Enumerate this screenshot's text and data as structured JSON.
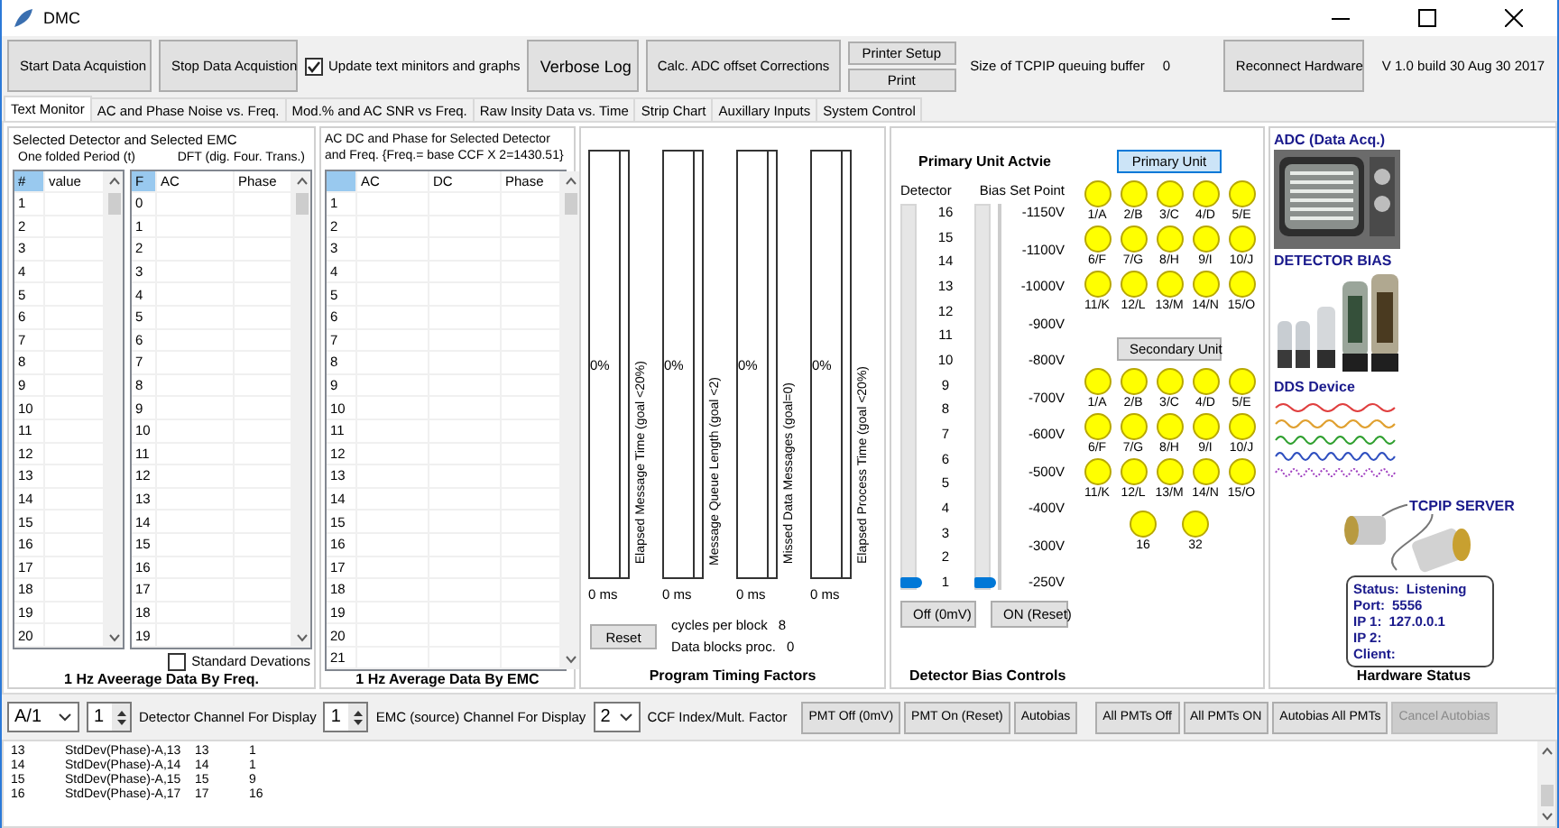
{
  "window": {
    "title": "DMC"
  },
  "toolbar": {
    "start_button": "Start Data Acquistion",
    "stop_button": "Stop Data Acquistion",
    "update_checkbox": {
      "label": "Update text minitors and graphs",
      "checked": true
    },
    "verbose_button": "Verbose Log",
    "calc_button": "Calc. ADC offset Corrections",
    "printer_setup_button": "Printer Setup",
    "print_button": "Print",
    "queue_label": "Size of TCPIP queuing buffer",
    "queue_value": "0",
    "reconnect_button": "Reconnect Hardware",
    "version": "V 1.0 build 30 Aug 30 2017"
  },
  "tabs": [
    {
      "label": "Text Monitor",
      "selected": true
    },
    {
      "label": "AC and Phase Noise vs. Freq.",
      "selected": false
    },
    {
      "label": "Mod.% and AC SNR vs Freq.",
      "selected": false
    },
    {
      "label": "Raw Insity Data vs. Time",
      "selected": false
    },
    {
      "label": "Strip Chart",
      "selected": false
    },
    {
      "label": "Auxillary Inputs",
      "selected": false
    },
    {
      "label": "System Control",
      "selected": false
    }
  ],
  "detector_panel": {
    "title": "Selected Detector and Selected EMC",
    "period_caption": "One folded Period (t)",
    "dft_caption": "DFT (dig. Four. Trans.)",
    "period_table": {
      "index_header": "#",
      "columns": [
        "value"
      ],
      "rows": [
        "1",
        "2",
        "3",
        "4",
        "5",
        "6",
        "7",
        "8",
        "9",
        "10",
        "11",
        "12",
        "13",
        "14",
        "15",
        "16",
        "17",
        "18",
        "19",
        "20"
      ]
    },
    "dft_table": {
      "index_header": "F",
      "columns": [
        "AC",
        "Phase"
      ],
      "rows": [
        "0",
        "1",
        "2",
        "3",
        "4",
        "5",
        "6",
        "7",
        "8",
        "9",
        "10",
        "11",
        "12",
        "13",
        "14",
        "15",
        "16",
        "17",
        "18",
        "19"
      ]
    },
    "std_dev_checkbox": {
      "label": "Standard Devations",
      "checked": false
    },
    "footer": "1 Hz Aveerage Data By Freq."
  },
  "emc_panel": {
    "title": "AC DC and Phase for Selected Detector and Freq.  {Freq.= base CCF X 2=1430.51}",
    "table": {
      "columns": [
        "AC",
        "DC",
        "Phase"
      ],
      "rows": [
        "1",
        "2",
        "3",
        "4",
        "5",
        "6",
        "7",
        "8",
        "9",
        "10",
        "11",
        "12",
        "13",
        "14",
        "15",
        "16",
        "17",
        "18",
        "19",
        "20",
        "21"
      ]
    },
    "footer": "1 Hz Average Data By EMC"
  },
  "timing_panel": {
    "bars": [
      {
        "label": "Elapsed Message Time (goal <20%)",
        "percent": "0%",
        "time": "0 ms"
      },
      {
        "label": "Message Queue Length (goal <2)",
        "percent": "0%",
        "time": "0 ms"
      },
      {
        "label": "Missed Data Messages (goal=0)",
        "percent": "0%",
        "time": "0 ms"
      },
      {
        "label": "Elapsed Process Time (goal <20%)",
        "percent": "0%",
        "time": "0 ms"
      }
    ],
    "reset_button": "Reset",
    "cycles_label": "cycles per block",
    "cycles_value": "8",
    "blocks_label": "Data blocks proc.",
    "blocks_value": "0",
    "footer": "Program Timing Factors"
  },
  "bias_panel": {
    "title": "Primary Unit Actvie",
    "detector_label": "Detector",
    "setpoint_label": "Bias Set Point",
    "detector_slider": {
      "ticks": [
        "16",
        "15",
        "14",
        "13",
        "12",
        "11",
        "10",
        "9",
        "8",
        "7",
        "6",
        "5",
        "4",
        "3",
        "2",
        "1"
      ],
      "level": 0
    },
    "setpoint_slider": {
      "ticks": [
        "-1150V",
        "-1100V",
        "-1000V",
        "-900V",
        "-800V",
        "-700V",
        "-600V",
        "-500V",
        "-400V",
        "-300V",
        "-250V"
      ],
      "level": 0
    },
    "off_button": "Off (0mV)",
    "on_button": "ON (Reset)",
    "units": [
      {
        "label": "Primary Unit",
        "selected": true,
        "lamps": [
          {
            "label": "1/A",
            "color": "#ffff00"
          },
          {
            "label": "2/B",
            "color": "#ffff00"
          },
          {
            "label": "3/C",
            "color": "#ffff00"
          },
          {
            "label": "4/D",
            "color": "#ffff00"
          },
          {
            "label": "5/E",
            "color": "#ffff00"
          },
          {
            "label": "6/F",
            "color": "#ffff00"
          },
          {
            "label": "7/G",
            "color": "#ffff00"
          },
          {
            "label": "8/H",
            "color": "#ffff00"
          },
          {
            "label": "9/I",
            "color": "#ffff00"
          },
          {
            "label": "10/J",
            "color": "#ffff00"
          },
          {
            "label": "11/K",
            "color": "#ffff00"
          },
          {
            "label": "12/L",
            "color": "#ffff00"
          },
          {
            "label": "13/M",
            "color": "#ffff00"
          },
          {
            "label": "14/N",
            "color": "#ffff00"
          },
          {
            "label": "15/O",
            "color": "#ffff00"
          }
        ]
      },
      {
        "label": "Secondary Unit",
        "selected": false,
        "lamps": [
          {
            "label": "1/A",
            "color": "#ffff00"
          },
          {
            "label": "2/B",
            "color": "#ffff00"
          },
          {
            "label": "3/C",
            "color": "#ffff00"
          },
          {
            "label": "4/D",
            "color": "#ffff00"
          },
          {
            "label": "5/E",
            "color": "#ffff00"
          },
          {
            "label": "6/F",
            "color": "#ffff00"
          },
          {
            "label": "7/G",
            "color": "#ffff00"
          },
          {
            "label": "8/H",
            "color": "#ffff00"
          },
          {
            "label": "9/I",
            "color": "#ffff00"
          },
          {
            "label": "10/J",
            "color": "#ffff00"
          },
          {
            "label": "11/K",
            "color": "#ffff00"
          },
          {
            "label": "12/L",
            "color": "#ffff00"
          },
          {
            "label": "13/M",
            "color": "#ffff00"
          },
          {
            "label": "14/N",
            "color": "#ffff00"
          },
          {
            "label": "15/O",
            "color": "#ffff00"
          }
        ]
      }
    ],
    "extra_lamps": [
      {
        "label": "16",
        "color": "#ffff00"
      },
      {
        "label": "32",
        "color": "#ffff00"
      }
    ],
    "footer": "Detector Bias Controls"
  },
  "hardware_panel": {
    "adc_title": "ADC (Data Acq.)",
    "bias_title": "DETECTOR BIAS",
    "dds_title": "DDS Device",
    "server_title": "TCPIP SERVER",
    "status": [
      {
        "label": "Status:",
        "value": "Listening"
      },
      {
        "label": "Port:",
        "value": "5556"
      },
      {
        "label": "IP 1:",
        "value": "127.0.0.1"
      },
      {
        "label": "IP 2:"
      },
      {
        "label": "Client:"
      }
    ],
    "footer": "Hardware Status"
  },
  "controls": {
    "detector_select": "A/1",
    "detector_spinner": "1",
    "detector_label": "Detector Channel For Display",
    "emc_spinner": "1",
    "emc_label": "EMC (source) Channel For Display",
    "ccf_select": "2",
    "ccf_label": "CCF Index/Mult. Factor",
    "pmt_buttons": [
      {
        "label": "PMT Off  (0mV)",
        "disabled": false
      },
      {
        "label": "PMT On  (Reset)",
        "disabled": false
      },
      {
        "label": "Autobias",
        "disabled": false
      }
    ],
    "all_buttons": [
      {
        "label": "All PMTs Off",
        "disabled": false
      },
      {
        "label": "All PMTs ON",
        "disabled": false
      },
      {
        "label": "Autobias All PMTs",
        "disabled": false
      },
      {
        "label": "Cancel Autobias",
        "disabled": true
      }
    ]
  },
  "log": {
    "lines": [
      [
        "13",
        "StdDev(Phase)-A,13",
        "13",
        "1"
      ],
      [
        "14",
        "StdDev(Phase)-A,14",
        "14",
        "1"
      ],
      [
        "15",
        "StdDev(Phase)-A,15",
        "15",
        "9"
      ],
      [
        "16",
        "StdDev(Phase)-A,17",
        "17",
        "16"
      ]
    ]
  }
}
